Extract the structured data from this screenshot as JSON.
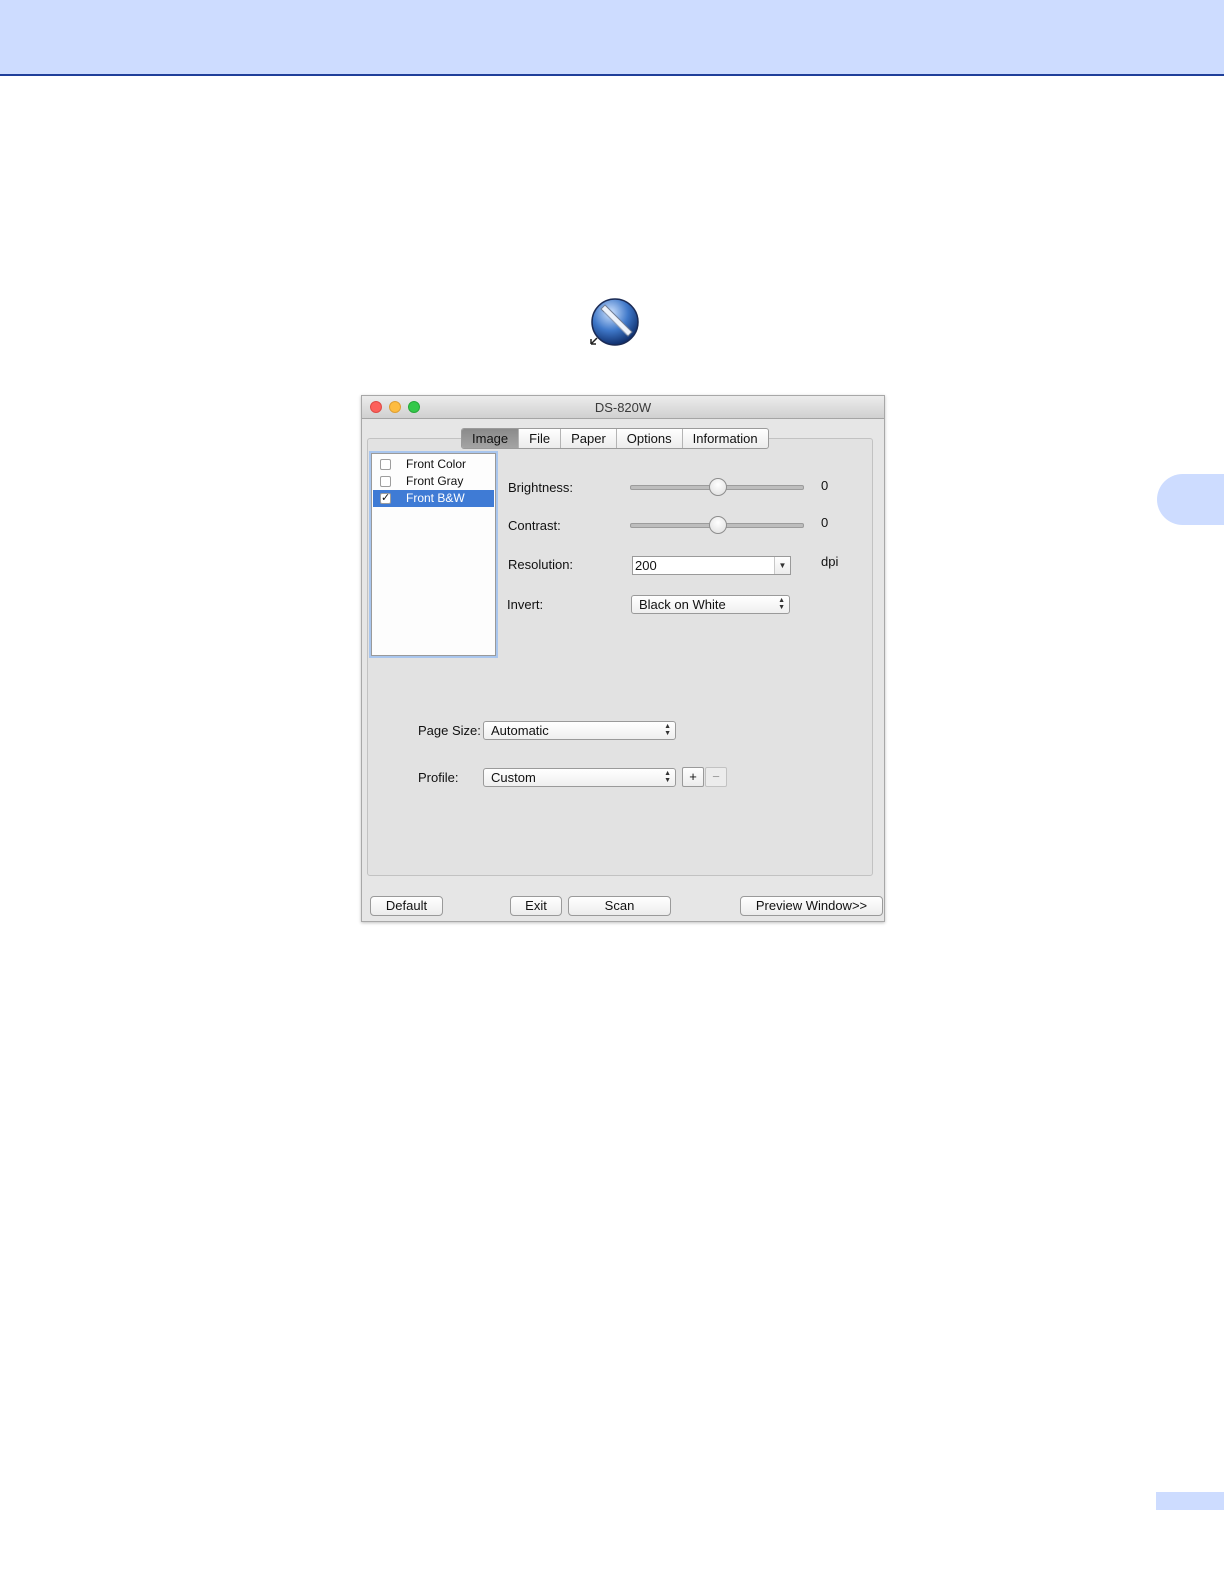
{
  "window": {
    "title": "DS-820W"
  },
  "tabs": [
    {
      "label": "Image",
      "active": true
    },
    {
      "label": "File",
      "active": false
    },
    {
      "label": "Paper",
      "active": false
    },
    {
      "label": "Options",
      "active": false
    },
    {
      "label": "Information",
      "active": false
    }
  ],
  "scan_modes": [
    {
      "label": "Front Color",
      "checked": false,
      "selected": false
    },
    {
      "label": "Front Gray",
      "checked": false,
      "selected": false
    },
    {
      "label": "Front B&W",
      "checked": true,
      "selected": true
    }
  ],
  "brightness": {
    "label": "Brightness:",
    "value": "0",
    "level_fraction": 0.5
  },
  "contrast": {
    "label": "Contrast:",
    "value": "0",
    "level_fraction": 0.5
  },
  "resolution": {
    "label": "Resolution:",
    "value": "200",
    "unit": "dpi"
  },
  "invert": {
    "label": "Invert:",
    "value": "Black on White"
  },
  "page_size": {
    "label": "Page Size:",
    "value": "Automatic"
  },
  "profile": {
    "label": "Profile:",
    "value": "Custom",
    "add_label": "+",
    "remove_label": "−"
  },
  "buttons": {
    "default": "Default",
    "exit": "Exit",
    "scan": "Scan",
    "preview": "Preview Window>>"
  },
  "colors": {
    "header_band": "#cddcff",
    "header_rule": "#1f3f9a",
    "selection": "#3f7bd5"
  },
  "icons": {
    "app_icon": "scanner-pen-globe-icon"
  }
}
